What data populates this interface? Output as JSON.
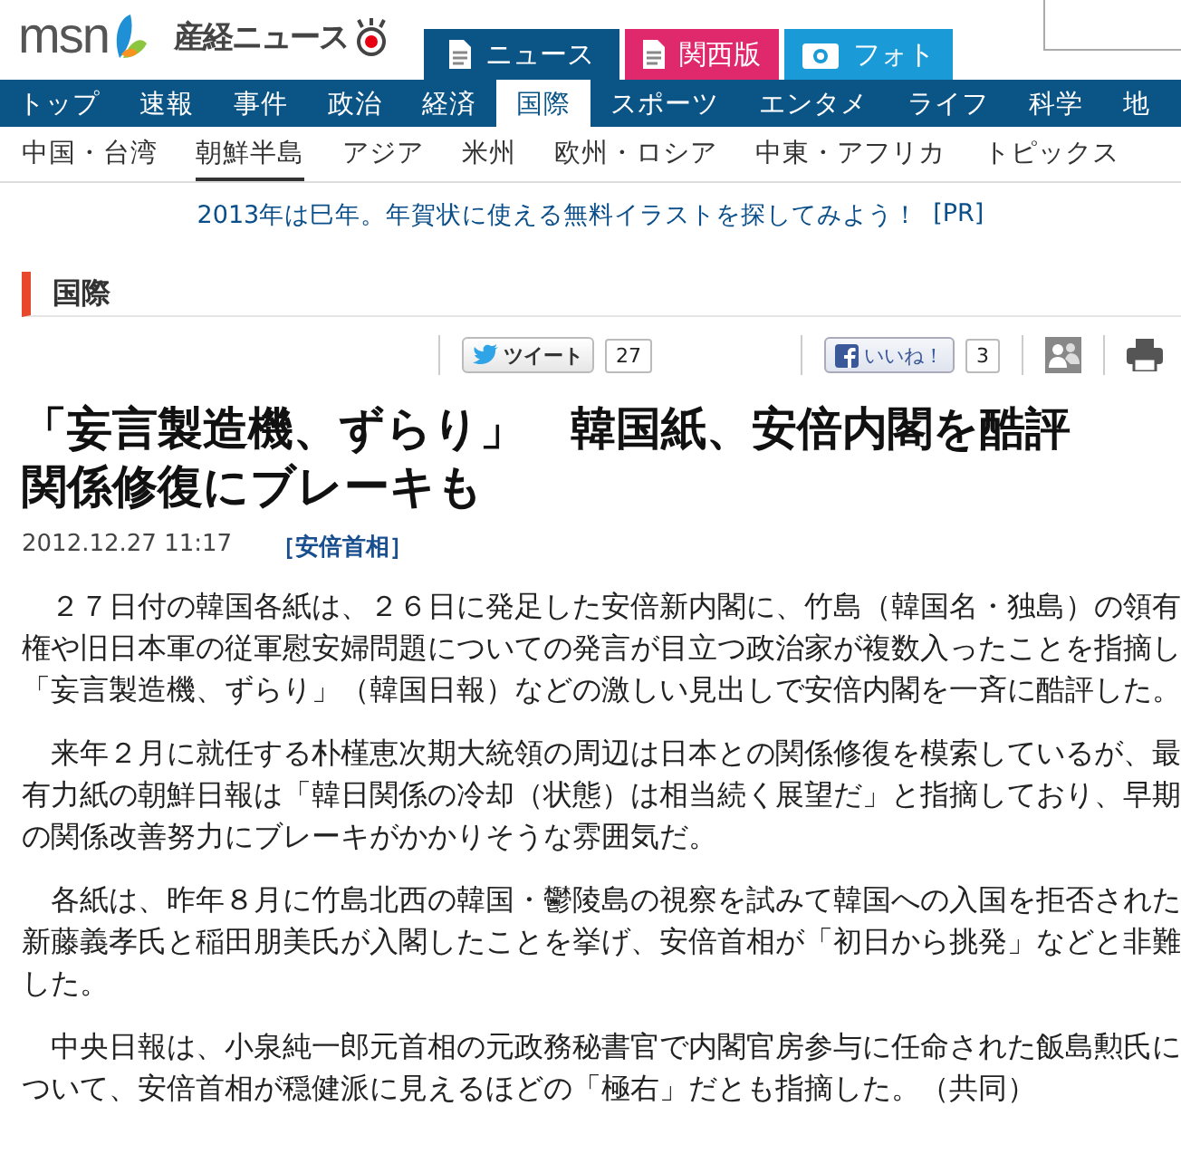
{
  "header": {
    "logo": "msn",
    "brand": "産経ニュース",
    "tabs": [
      {
        "label": "ニュース",
        "selected": true,
        "color": "#0b5486",
        "kind": "document"
      },
      {
        "label": "関西版",
        "selected": false,
        "color": "#e0286c",
        "kind": "document"
      },
      {
        "label": "フォト",
        "selected": false,
        "color": "#1a9bd7",
        "kind": "camera"
      }
    ]
  },
  "nav": [
    {
      "label": "トップ",
      "selected": false
    },
    {
      "label": "速報",
      "selected": false
    },
    {
      "label": "事件",
      "selected": false
    },
    {
      "label": "政治",
      "selected": false
    },
    {
      "label": "経済",
      "selected": false
    },
    {
      "label": "国際",
      "selected": true
    },
    {
      "label": "スポーツ",
      "selected": false
    },
    {
      "label": "エンタメ",
      "selected": false
    },
    {
      "label": "ライフ",
      "selected": false
    },
    {
      "label": "科学",
      "selected": false
    },
    {
      "label": "地",
      "selected": false
    }
  ],
  "subnav": [
    {
      "label": "中国・台湾",
      "selected": false
    },
    {
      "label": "朝鮮半島",
      "selected": true
    },
    {
      "label": "アジア",
      "selected": false
    },
    {
      "label": "米州",
      "selected": false
    },
    {
      "label": "欧州・ロシア",
      "selected": false
    },
    {
      "label": "中東・アフリカ",
      "selected": false
    },
    {
      "label": "トピックス",
      "selected": false
    }
  ],
  "promo": {
    "text": "2013年は巳年。年賀状に使える無料イラストを探してみよう！",
    "tag": "[PR]"
  },
  "section": "国際",
  "share": {
    "tweet": "ツイート",
    "tweet_count": "27",
    "like": "いいね！",
    "like_count": "3"
  },
  "article": {
    "title": [
      "「妄言製造機、ずらり」　韓国紙、安倍内閣を酷評",
      "関係修復にブレーキも"
    ],
    "date": "2012.12.27 11:17",
    "topic": "［安倍首相］",
    "paragraphs": [
      "　２７日付の韓国各紙は、２６日に発足した安倍新内閣に、竹島（韓国名・独島）の領有権や旧日本軍の従軍慰安婦問題についての発言が目立つ政治家が複数入ったことを指摘し「妄言製造機、ずらり」（韓国日報）などの激しい見出しで安倍内閣を一斉に酷評した。",
      "　来年２月に就任する朴槿恵次期大統領の周辺は日本との関係修復を模索しているが、最有力紙の朝鮮日報は「韓日関係の冷却（状態）は相当続く展望だ」と指摘しており、早期の関係改善努力にブレーキがかかりそうな雰囲気だ。",
      "　各紙は、昨年８月に竹島北西の韓国・鬱陵島の視察を試みて韓国への入国を拒否された新藤義孝氏と稲田朋美氏が入閣したことを挙げ、安倍首相が「初日から挑発」などと非難した。",
      "　中央日報は、小泉純一郎元首相の元政務秘書官で内閣官房参与に任命された飯島勲氏について、安倍首相が穏健派に見えるほどの「極右」だとも指摘した。（共同）"
    ]
  }
}
